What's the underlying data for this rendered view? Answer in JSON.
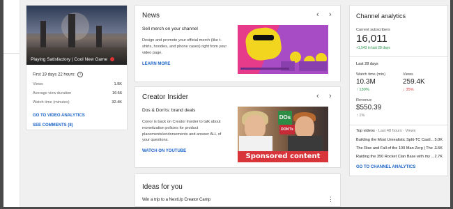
{
  "video": {
    "title": "Playing Satisfactory | Cool New Game",
    "period": "First 19 days 22 hours:",
    "stats": [
      {
        "label": "Views",
        "value": "1.9K"
      },
      {
        "label": "Average view duration",
        "value": "16:56"
      },
      {
        "label": "Watch time (minutes)",
        "value": "32.4K"
      }
    ],
    "link_analytics": "GO TO VIDEO ANALYTICS",
    "link_comments": "SEE COMMENTS (8)"
  },
  "news": {
    "title": "News",
    "subtitle": "Sell merch on your channel",
    "body": "Design and promote your official merch (like t-shirts, hoodies, and phone cases) right from your video page.",
    "link": "LEARN MORE"
  },
  "creator": {
    "title": "Creator Insider",
    "subtitle": "Dos & Don'ts: brand deals",
    "body": "Conor is back on Creator Insider to talk about monetization policies for product placements/endorsements and answer ALL of your questions.",
    "link": "WATCH ON YOUTUBE",
    "image_banner": "Sponsored content",
    "sign_text": "DOs",
    "sign_text2": "DON'Ts"
  },
  "ideas": {
    "title": "Ideas for you",
    "item": "Win a trip to a NextUp Creator Camp"
  },
  "analytics": {
    "title": "Channel analytics",
    "current_label": "Current subscribers",
    "subscribers": "16,011",
    "subs_delta": "+1,543 in last 28 days",
    "period": "Last 28 days",
    "watch_label": "Watch time (min)",
    "watch_value": "10.3M",
    "watch_delta": "130%",
    "views_label": "Views",
    "views_value": "259.4K",
    "views_delta": "35%",
    "revenue_label": "Revenue",
    "revenue_value": "$550.39",
    "revenue_delta": "1%",
    "top_videos_label": "Top videos",
    "top_videos_period": "· Last 48 hours · Views",
    "top_videos": [
      {
        "title": "Building the Most Unrealistic Split-TC Castl...",
        "views": "5.0K"
      },
      {
        "title": "The Rise and Fall of the 100 Man Zerg | The ...",
        "views": "3.5K"
      },
      {
        "title": "Raiding the 350 Rocket Clan Base with my ...",
        "views": "2.7K"
      }
    ],
    "link": "GO TO CHANNEL ANALYTICS"
  }
}
